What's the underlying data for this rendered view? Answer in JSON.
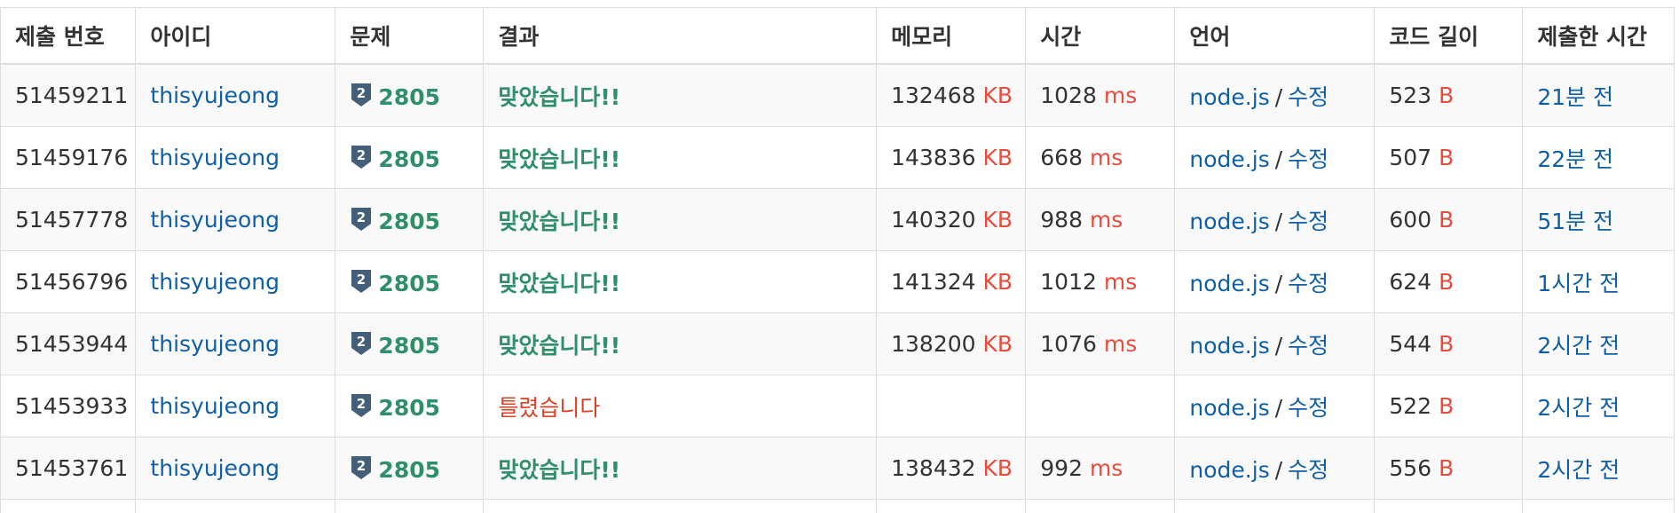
{
  "headers": [
    "제출 번호",
    "아이디",
    "문제",
    "결과",
    "메모리",
    "시간",
    "언어",
    "코드 길이",
    "제출한 시간"
  ],
  "units": {
    "memory": "KB",
    "time": "ms",
    "code": "B"
  },
  "colors": {
    "link": "#0f5fa8",
    "accepted": "#2f8f6a",
    "wrong": "#dd4124",
    "unit": "#e74c3c",
    "tier_badge": "#435f7a"
  },
  "rows": [
    {
      "id": "51459211",
      "user": "thisyujeong",
      "tier": "2",
      "problem": "2805",
      "result": "맞았습니다!!",
      "result_type": "accepted",
      "memory": "132468",
      "memory_unit": "KB",
      "time": "1028",
      "time_unit": "ms",
      "lang": "node.js",
      "sep": "/",
      "edit": "수정",
      "code": "523",
      "code_unit": "B",
      "when": "21분 전"
    },
    {
      "id": "51459176",
      "user": "thisyujeong",
      "tier": "2",
      "problem": "2805",
      "result": "맞았습니다!!",
      "result_type": "accepted",
      "memory": "143836",
      "memory_unit": "KB",
      "time": "668",
      "time_unit": "ms",
      "lang": "node.js",
      "sep": "/",
      "edit": "수정",
      "code": "507",
      "code_unit": "B",
      "when": "22분 전"
    },
    {
      "id": "51457778",
      "user": "thisyujeong",
      "tier": "2",
      "problem": "2805",
      "result": "맞았습니다!!",
      "result_type": "accepted",
      "memory": "140320",
      "memory_unit": "KB",
      "time": "988",
      "time_unit": "ms",
      "lang": "node.js",
      "sep": "/",
      "edit": "수정",
      "code": "600",
      "code_unit": "B",
      "when": "51분 전"
    },
    {
      "id": "51456796",
      "user": "thisyujeong",
      "tier": "2",
      "problem": "2805",
      "result": "맞았습니다!!",
      "result_type": "accepted",
      "memory": "141324",
      "memory_unit": "KB",
      "time": "1012",
      "time_unit": "ms",
      "lang": "node.js",
      "sep": "/",
      "edit": "수정",
      "code": "624",
      "code_unit": "B",
      "when": "1시간 전"
    },
    {
      "id": "51453944",
      "user": "thisyujeong",
      "tier": "2",
      "problem": "2805",
      "result": "맞았습니다!!",
      "result_type": "accepted",
      "memory": "138200",
      "memory_unit": "KB",
      "time": "1076",
      "time_unit": "ms",
      "lang": "node.js",
      "sep": "/",
      "edit": "수정",
      "code": "544",
      "code_unit": "B",
      "when": "2시간 전"
    },
    {
      "id": "51453933",
      "user": "thisyujeong",
      "tier": "2",
      "problem": "2805",
      "result": "틀렸습니다",
      "result_type": "wrong",
      "memory": "",
      "memory_unit": "",
      "time": "",
      "time_unit": "",
      "lang": "node.js",
      "sep": "/",
      "edit": "수정",
      "code": "522",
      "code_unit": "B",
      "when": "2시간 전"
    },
    {
      "id": "51453761",
      "user": "thisyujeong",
      "tier": "2",
      "problem": "2805",
      "result": "맞았습니다!!",
      "result_type": "accepted",
      "memory": "138432",
      "memory_unit": "KB",
      "time": "992",
      "time_unit": "ms",
      "lang": "node.js",
      "sep": "/",
      "edit": "수정",
      "code": "556",
      "code_unit": "B",
      "when": "2시간 전"
    }
  ]
}
